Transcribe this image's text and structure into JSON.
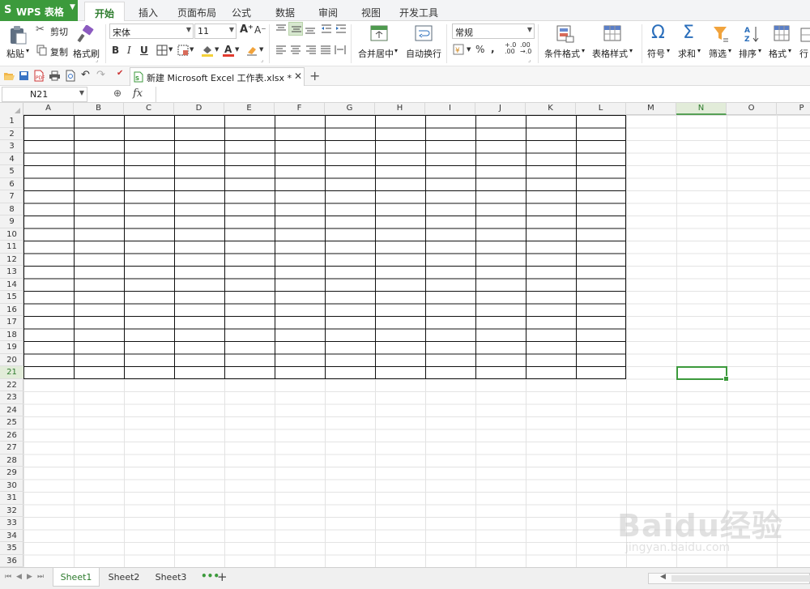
{
  "app": {
    "logo": "S",
    "name": "WPS 表格"
  },
  "menu_tabs": [
    "开始",
    "插入",
    "页面布局",
    "公式",
    "数据",
    "审阅",
    "视图",
    "开发工具"
  ],
  "active_tab": "开始",
  "ribbon": {
    "paste": "粘贴",
    "cut": "剪切",
    "copy": "复制",
    "format_painter": "格式刷",
    "font_name": "宋体",
    "font_size": "11",
    "bold": "B",
    "italic": "I",
    "underline": "U",
    "merge_center": "合并居中",
    "wrap_text": "自动换行",
    "number_format": "常规",
    "conditional_format": "条件格式",
    "table_style": "表格样式",
    "symbol": "符号",
    "sum": "求和",
    "filter": "筛选",
    "sort": "排序",
    "format": "格式",
    "row_col": "行"
  },
  "document_tab": {
    "title": "新建 Microsoft Excel 工作表.xlsx *"
  },
  "formula_bar": {
    "name_box": "N21",
    "fx": "fx",
    "value": ""
  },
  "columns": [
    "A",
    "B",
    "C",
    "D",
    "E",
    "F",
    "G",
    "H",
    "I",
    "J",
    "K",
    "L",
    "M",
    "N",
    "O",
    "P"
  ],
  "rows": [
    "1",
    "2",
    "3",
    "4",
    "5",
    "6",
    "7",
    "8",
    "9",
    "10",
    "11",
    "12",
    "13",
    "14",
    "15",
    "16",
    "17",
    "18",
    "19",
    "20",
    "21",
    "22",
    "23",
    "24",
    "25",
    "26",
    "27",
    "28",
    "29",
    "30",
    "31",
    "32",
    "33",
    "34",
    "35",
    "36"
  ],
  "selected_cell": {
    "column": "N",
    "row": "21"
  },
  "bordered_range": "A1:L21",
  "sheets": [
    "Sheet1",
    "Sheet2",
    "Sheet3"
  ],
  "active_sheet": "Sheet1",
  "watermark": {
    "text": "Baidu经验",
    "url": "jingyan.baidu.com"
  },
  "colors": {
    "accent_green": "#3c9a3c",
    "selected_header": "#e2ecd9"
  }
}
